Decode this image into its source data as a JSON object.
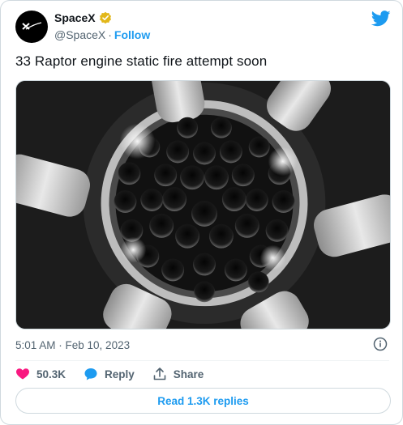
{
  "author": {
    "name": "SpaceX",
    "handle": "@SpaceX",
    "separator": "·",
    "follow_label": "Follow"
  },
  "tweet": {
    "text": "33 Raptor engine static fire attempt soon",
    "timestamp": "5:01 AM · Feb 10, 2023"
  },
  "actions": {
    "like_count": "50.3K",
    "reply_label": "Reply",
    "share_label": "Share"
  },
  "replies_button": "Read 1.3K replies",
  "colors": {
    "accent": "#1d9bf0",
    "like": "#f91880",
    "text": "#0f1419",
    "muted": "#536471",
    "verified": "#e2b719"
  },
  "icons": {
    "avatar": "spacex-logo-icon",
    "verified": "verified-badge-icon",
    "brand": "twitter-bird-icon",
    "info": "info-icon",
    "like": "heart-icon",
    "reply": "speech-bubble-icon",
    "share": "share-upload-icon"
  }
}
